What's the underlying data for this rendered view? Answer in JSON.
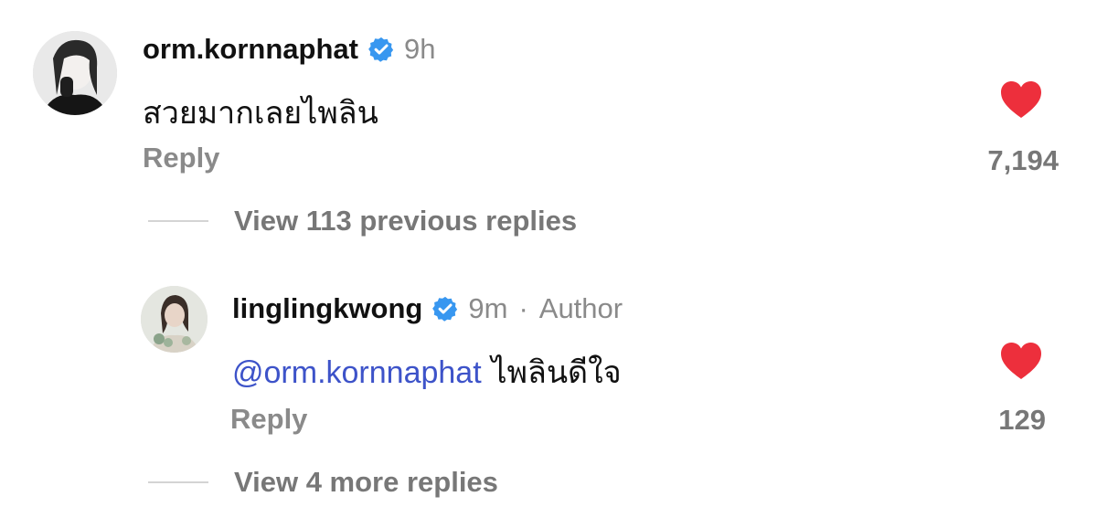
{
  "comments": [
    {
      "username": "orm.kornnaphat",
      "time": "9h",
      "text": "สวยมากเลยไพลิน",
      "reply_label": "Reply",
      "likes": "7,194"
    },
    {
      "username": "linglingkwong",
      "time": "9m",
      "separator": "·",
      "badge": "Author",
      "mention": "@orm.kornnaphat",
      "text": "ไพลินดีใจ",
      "reply_label": "Reply",
      "likes": "129"
    }
  ],
  "thread": {
    "view_previous": "View 113 previous replies",
    "view_more": "View 4 more replies"
  },
  "colors": {
    "verified_badge": "#3897f0",
    "heart": "#ed2f3c",
    "mention": "#3d53c9",
    "secondary_text": "#8a8a8a"
  },
  "icons": {
    "verified": "verified-badge-icon",
    "like": "heart-icon"
  }
}
